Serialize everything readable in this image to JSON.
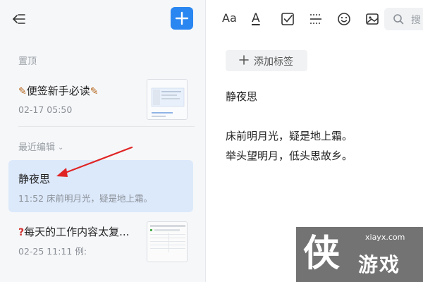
{
  "sidebar": {
    "pinned_label": "置顶",
    "recent_label": "最近编辑",
    "notes": [
      {
        "title": "便签新手必读",
        "time": "02-17 05:50",
        "emoji": "🪄"
      },
      {
        "title": "静夜思",
        "time": "11:52",
        "preview": "床前明月光，疑是地上霜。"
      },
      {
        "title": "每天的工作内容太复...",
        "time": "02-25 11:11",
        "preview": "例:",
        "emoji": "❓"
      }
    ]
  },
  "toolbar": {
    "icons": [
      "font-size-icon",
      "font-color-icon",
      "checkbox-icon",
      "divider-line-icon",
      "emoji-icon",
      "image-icon"
    ],
    "font_size_glyph": "Aa",
    "font_color_glyph": "A",
    "search_placeholder": "搜"
  },
  "editor": {
    "add_tag_label": "添加标签",
    "title": "静夜思",
    "lines": [
      "床前明月光，疑是地上霜。",
      "举头望明月，低头思故乡。"
    ]
  },
  "watermark": {
    "site": "xiayx.com",
    "logo_char": "侠",
    "name": "游戏"
  },
  "colors": {
    "accent": "#2a86f0",
    "active_bg": "#dce9fb",
    "annotation": "#e02424"
  }
}
